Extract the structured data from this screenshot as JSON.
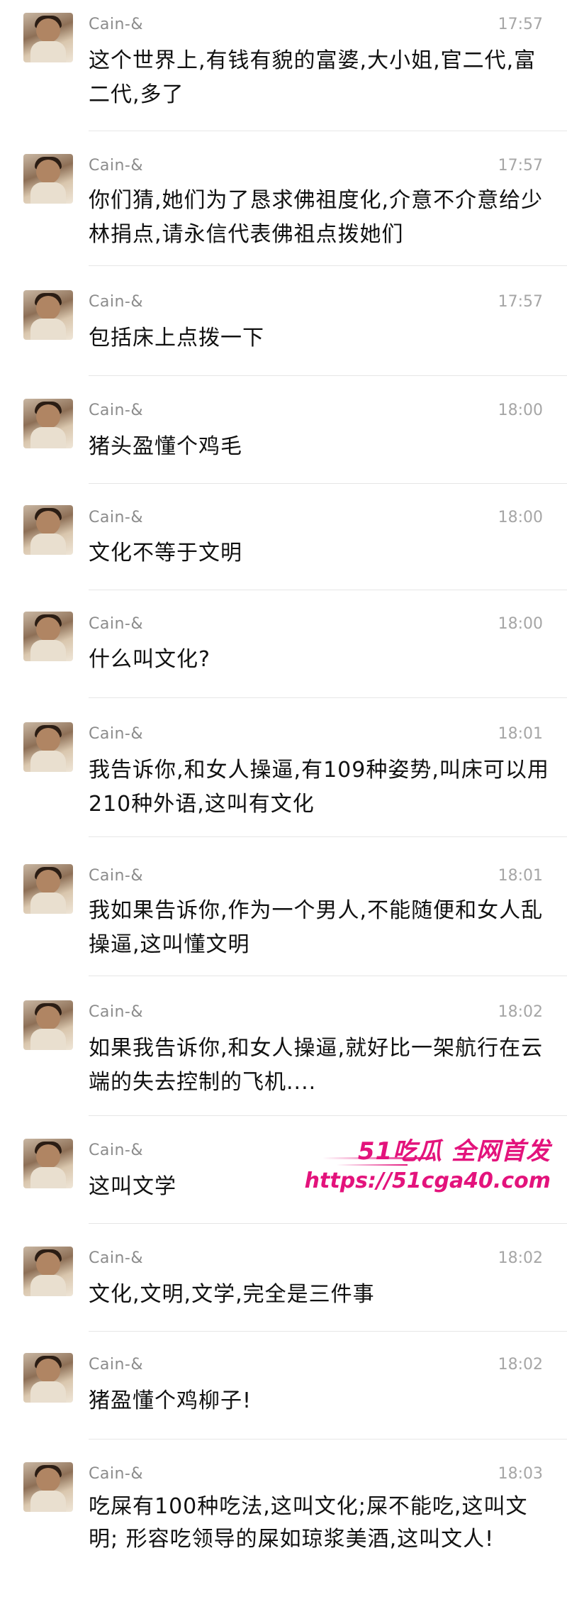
{
  "messages": [
    {
      "name": "Cain-&",
      "time": "17:57",
      "text": "这个世界上,有钱有貌的富婆,大小姐,官二代,富二代,多了"
    },
    {
      "name": "Cain-&",
      "time": "17:57",
      "text": "你们猜,她们为了恳求佛祖度化,介意不介意给少林捐点,请永信代表佛祖点拨她们"
    },
    {
      "name": "Cain-&",
      "time": "17:57",
      "text": "包括床上点拨一下"
    },
    {
      "name": "Cain-&",
      "time": "18:00",
      "text": "猪头盈懂个鸡毛"
    },
    {
      "name": "Cain-&",
      "time": "18:00",
      "text": "文化不等于文明"
    },
    {
      "name": "Cain-&",
      "time": "18:00",
      "text": "什么叫文化?"
    },
    {
      "name": "Cain-&",
      "time": "18:01",
      "text": "我告诉你,和女人操逼,有109种姿势,叫床可以用210种外语,这叫有文化"
    },
    {
      "name": "Cain-&",
      "time": "18:01",
      "text": "我如果告诉你,作为一个男人,不能随便和女人乱操逼,这叫懂文明"
    },
    {
      "name": "Cain-&",
      "time": "18:02",
      "text": "如果我告诉你,和女人操逼,就好比一架航行在云端的失去控制的飞机...."
    },
    {
      "name": "Cain-&",
      "time": "",
      "text": "这叫文学"
    },
    {
      "name": "Cain-&",
      "time": "18:02",
      "text": "文化,文明,文学,完全是三件事"
    },
    {
      "name": "Cain-&",
      "time": "18:02",
      "text": "猪盈懂个鸡柳子!"
    },
    {
      "name": "Cain-&",
      "time": "18:03",
      "text": "吃屎有100种吃法,这叫文化;屎不能吃,这叫文明; 形容吃领导的屎如琼浆美酒,这叫文人!"
    }
  ],
  "watermark": {
    "top": "51吃瓜 全网首发",
    "bottom": "https://51cga40.com"
  },
  "colors": {
    "name": "#8c8c8c",
    "time": "#a6a6a6",
    "text": "#111111",
    "watermark": "#e3137c"
  }
}
